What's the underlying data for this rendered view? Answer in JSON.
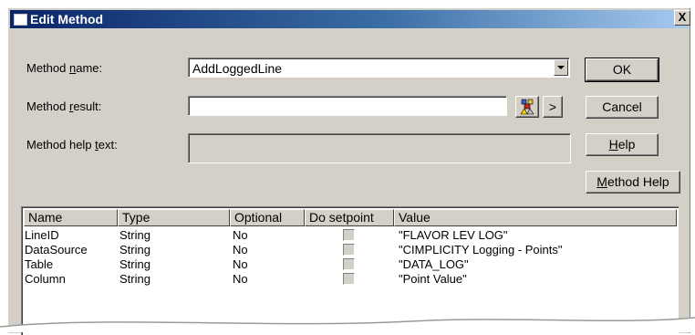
{
  "window": {
    "title": "Edit Method",
    "close_label": "X"
  },
  "form": {
    "method_name": {
      "label_pre": "Method ",
      "label_key": "n",
      "label_post": "ame:",
      "value": "AddLoggedLine"
    },
    "method_result": {
      "label_pre": "Method ",
      "label_key": "r",
      "label_post": "esult:",
      "value": ""
    },
    "method_help_text": {
      "label_pre": "Method help ",
      "label_key": "t",
      "label_post": "ext:",
      "value": ""
    },
    "expand_label": ">"
  },
  "buttons": {
    "ok": "OK",
    "cancel": "Cancel",
    "help_key": "H",
    "help_rest": "elp",
    "method_help_key": "M",
    "method_help_rest": "ethod Help"
  },
  "table": {
    "columns": [
      "Name",
      "Type",
      "Optional",
      "Do setpoint",
      "Value"
    ],
    "rows": [
      {
        "name": "LineID",
        "type": "String",
        "optional": "No",
        "do_setpoint": false,
        "value": "\"FLAVOR LEV LOG\""
      },
      {
        "name": "DataSource",
        "type": "String",
        "optional": "No",
        "do_setpoint": false,
        "value": "\"CIMPLICITY Logging - Points\""
      },
      {
        "name": "Table",
        "type": "String",
        "optional": "No",
        "do_setpoint": false,
        "value": "\"DATA_LOG\""
      },
      {
        "name": "Column",
        "type": "String",
        "optional": "No",
        "do_setpoint": false,
        "value": "\"Point Value\""
      }
    ]
  }
}
